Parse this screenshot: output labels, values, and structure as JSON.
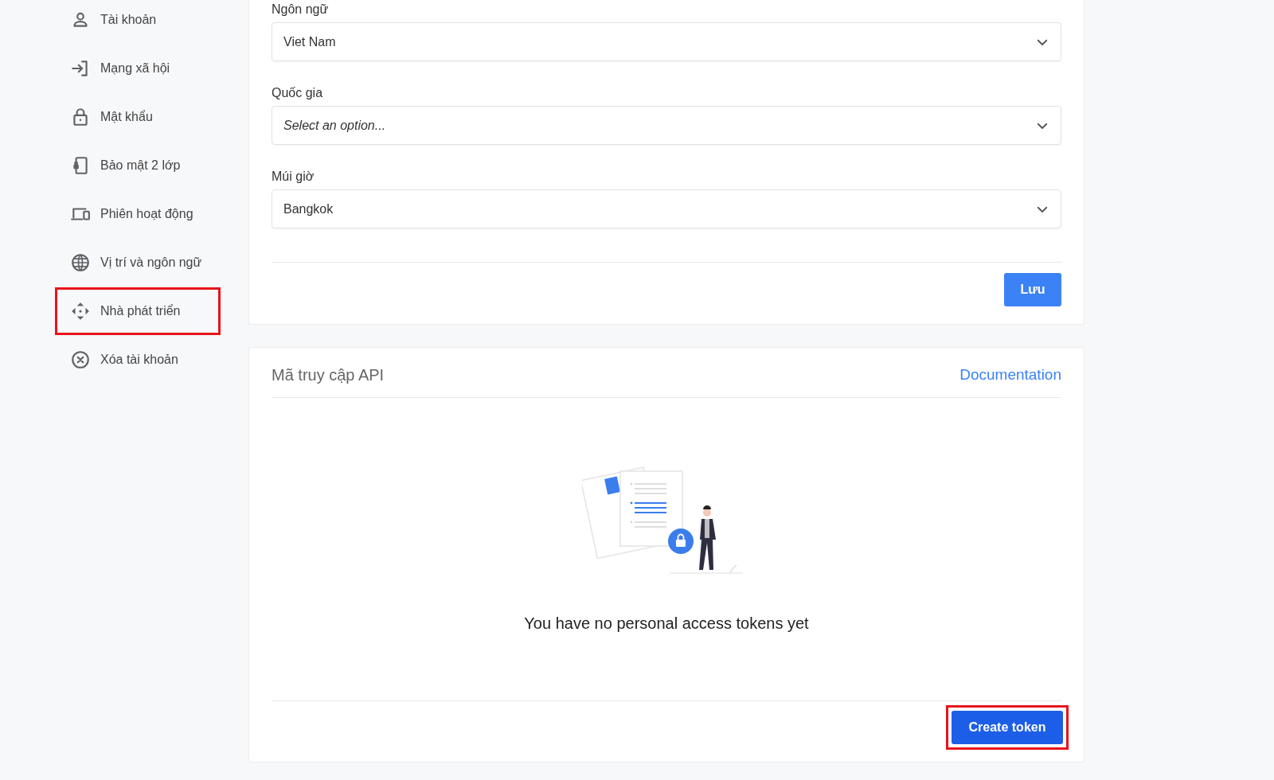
{
  "sidebar": {
    "items": [
      {
        "kind": "user",
        "label": "Tài khoản",
        "selected": false,
        "highlighted": false
      },
      {
        "kind": "login",
        "label": "Mạng xã hội",
        "selected": false,
        "highlighted": false
      },
      {
        "kind": "lock",
        "label": "Mật khẩu",
        "selected": false,
        "highlighted": false
      },
      {
        "kind": "phone-lock",
        "label": "Bảo mật 2 lớp",
        "selected": false,
        "highlighted": false
      },
      {
        "kind": "devices",
        "label": "Phiên hoạt động",
        "selected": false,
        "highlighted": false
      },
      {
        "kind": "globe",
        "label": "Vị trí và ngôn ngữ",
        "selected": false,
        "highlighted": false
      },
      {
        "kind": "arrows",
        "label": "Nhà phát triển",
        "selected": false,
        "highlighted": true
      },
      {
        "kind": "x-circle",
        "label": "Xóa tài khoản",
        "selected": false,
        "highlighted": false
      }
    ]
  },
  "settings_form": {
    "fields": [
      {
        "label": "Ngôn ngữ",
        "value": "Viet Nam"
      },
      {
        "label": "Quốc gia",
        "placeholder": "Select an option..."
      },
      {
        "label": "Múi giờ",
        "value": "Bangkok"
      }
    ],
    "save_button": "Lưu"
  },
  "api_tokens": {
    "title": "Mã truy cập API",
    "link": "Documentation",
    "empty_message": "You have no personal access tokens yet",
    "create_button": {
      "label": "Create token",
      "highlighted": true
    }
  }
}
